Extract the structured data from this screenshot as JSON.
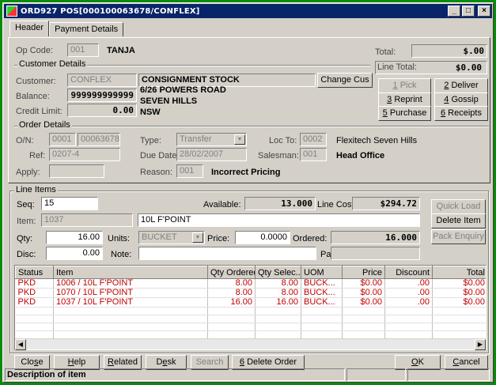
{
  "window": {
    "title": "ORD927 POS[000100063678/CONFLEX]",
    "min": "_",
    "max": "□",
    "close": "×"
  },
  "tabs": [
    "Header",
    "Payment Details"
  ],
  "header": {
    "op_code_label": "Op Code:",
    "op_code": "001",
    "op_name": "TANJA",
    "total_label": "Total:",
    "total": "$.00",
    "line_total_label": "Line Total:",
    "line_total": "$0.00",
    "customer_details_label": "Customer Details",
    "customer_label": "Customer:",
    "customer": "CONFLEX",
    "customer_name": "CONSIGNMENT STOCK",
    "change_cus": "Change Cus",
    "balance_label": "Balance:",
    "balance": "999999999999",
    "address1": "6/26 POWERS ROAD",
    "address2": "SEVEN HILLS",
    "address3": "NSW",
    "credit_limit_label": "Credit Limit:",
    "credit_limit": "0.00",
    "buttons": {
      "pick": "1 Pick",
      "deliver": "2 Deliver",
      "reprint": "3 Reprint",
      "gossip": "4 Gossip",
      "purchase": "5 Purchase",
      "receipts": "6 Receipts"
    },
    "order_details_label": "Order Details",
    "on_label": "O/N:",
    "on1": "0001",
    "on2": "00063678",
    "type_label": "Type:",
    "type": "Transfer",
    "loc_to_label": "Loc To:",
    "loc_to": "0002",
    "loc_to_name": "Flexitech Seven Hills",
    "ref_label": "Ref:",
    "ref": "0207-4",
    "due_date_label": "Due Date:",
    "due_date": "28/02/2007",
    "salesman_label": "Salesman:",
    "salesman": "001",
    "salesman_name": "Head Office",
    "apply_label": "Apply:",
    "apply": "",
    "reason_label": "Reason:",
    "reason": "001",
    "reason_name": "Incorrect Pricing"
  },
  "line_items": {
    "label": "Line Items",
    "seq_label": "Seq:",
    "seq": "15",
    "available_label": "Available:",
    "available": "13.000",
    "line_cost_label": "Line Cost:",
    "line_cost": "$294.72",
    "quick_load": "Quick Load",
    "delete_item": "Delete Item",
    "pack_enquiry": "Pack Enquiry",
    "item_label": "Item:",
    "item": "1037",
    "item_desc": "10L F'POINT",
    "qty_label": "Qty:",
    "qty": "16.00",
    "units_label": "Units:",
    "units": "BUCKET",
    "price_label": "Price:",
    "price": "0.0000",
    "ordered_label": "Ordered:",
    "ordered": "16.000",
    "disc_label": "Disc:",
    "disc": "0.00",
    "note_label": "Note:",
    "note": "",
    "pack_label": "Pack:",
    "pack": ""
  },
  "grid": {
    "columns": [
      "Status",
      "Item",
      "Qty Ordered",
      "Qty Selec...",
      "UOM",
      "Price",
      "Discount",
      "Total"
    ],
    "rows": [
      [
        "PKD",
        "1006 / 10L F'POINT",
        "8.00",
        "8.00",
        "BUCK...",
        "$0.00",
        ".00",
        "$0.00"
      ],
      [
        "PKD",
        "1070 / 10L F'POINT",
        "8.00",
        "8.00",
        "BUCK...",
        "$0.00",
        ".00",
        "$0.00"
      ],
      [
        "PKD",
        "1037 / 10L F'POINT",
        "16.00",
        "16.00",
        "BUCK...",
        "$0.00",
        ".00",
        "$0.00"
      ]
    ]
  },
  "footer": {
    "close": "Close",
    "help": "Help",
    "related": "Related",
    "desk": "Desk",
    "search": "Search",
    "delete_order": "6 Delete Order",
    "ok": "OK",
    "cancel": "Cancel"
  },
  "status": {
    "text": "Description of item"
  }
}
